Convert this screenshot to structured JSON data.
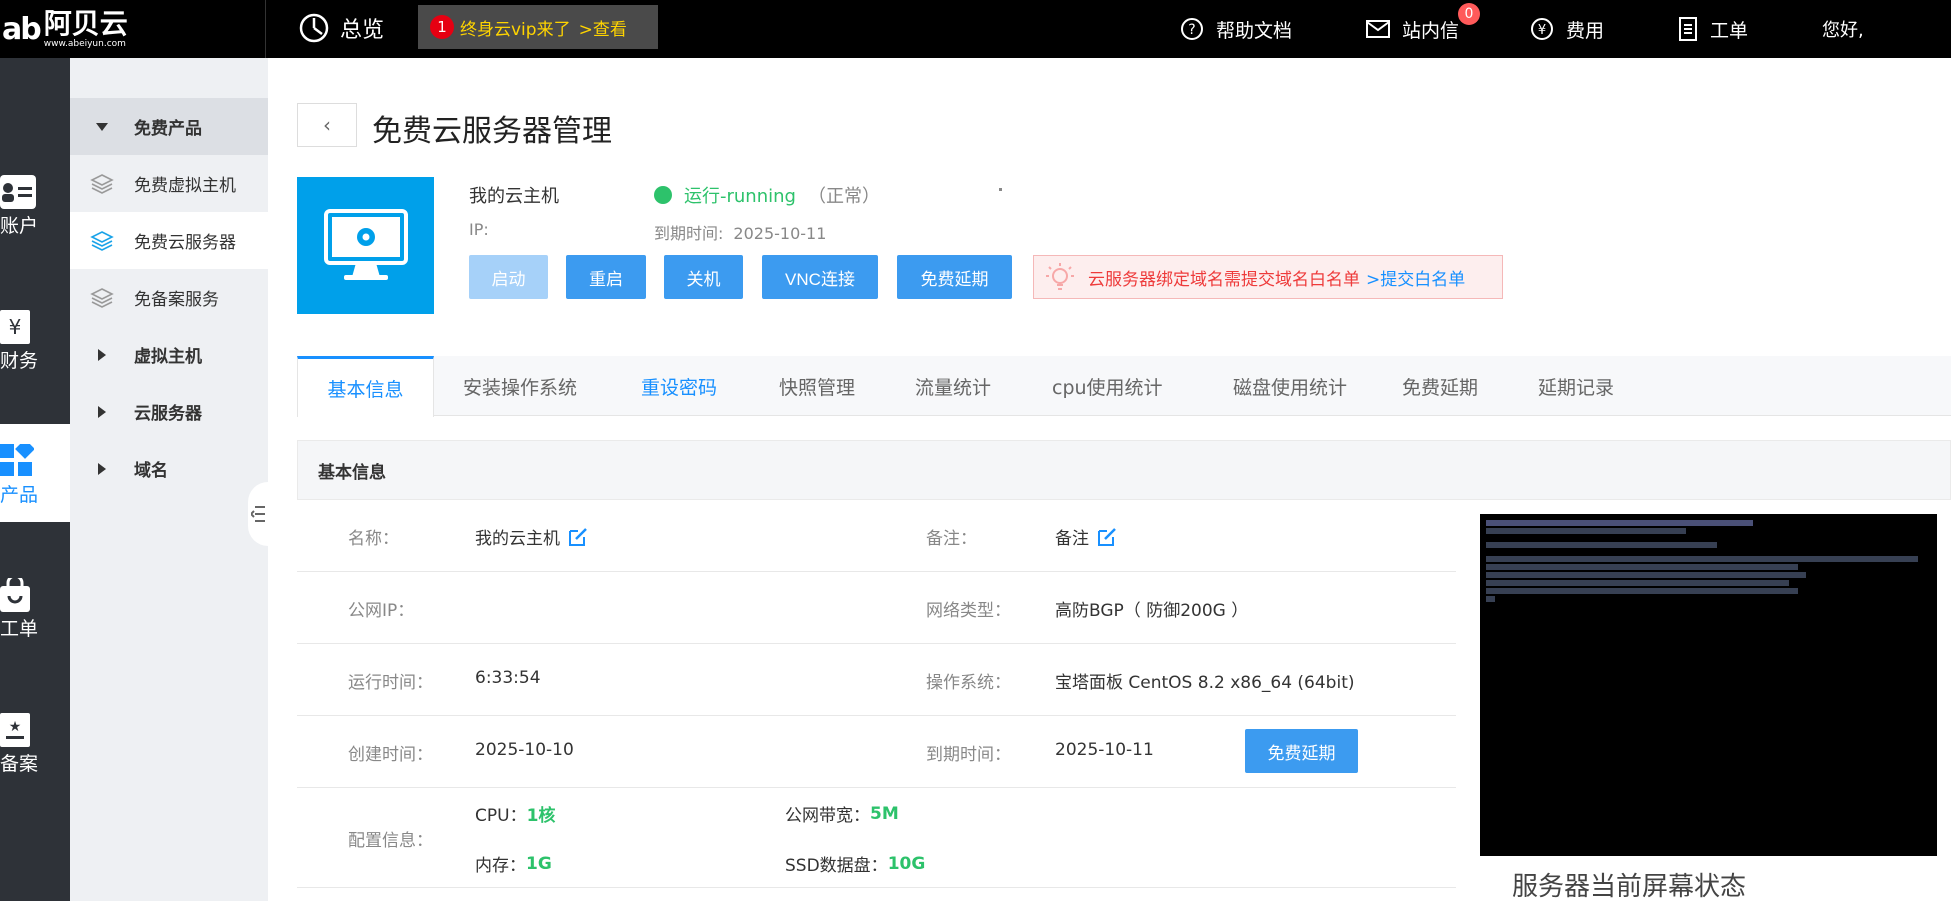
{
  "header": {
    "logo_cn": "阿贝云",
    "logo_en": "www.abeiyun.com",
    "overview": "总览",
    "promo_badge": "1",
    "promo_text": "终身云vip来了",
    "promo_link": ">查看",
    "help": "帮助文档",
    "messages": "站内信",
    "messages_count": "0",
    "fees": "费用",
    "tickets": "工单",
    "greeting": "您好,"
  },
  "rail": {
    "account": "账户",
    "finance": "财务",
    "products": "产品",
    "tickets": "工单",
    "beian": "备案"
  },
  "sidebar": {
    "free_products": "免费产品",
    "free_vhost": "免费虚拟主机",
    "free_cloud_server": "免费云服务器",
    "free_beian": "免备案服务",
    "vhost": "虚拟主机",
    "cloud_server": "云服务器",
    "domain": "域名"
  },
  "page": {
    "back": "‹",
    "title": "免费云服务器管理"
  },
  "server": {
    "name": "我的云主机",
    "status": "运行-running",
    "status_note": "（正常）",
    "ip_label": "IP:",
    "expire_label": "到期时间:",
    "expire_date": "2025-10-11"
  },
  "actions": {
    "start": "启动",
    "restart": "重启",
    "shutdown": "关机",
    "vnc": "VNC连接",
    "extend": "免费延期"
  },
  "notice": {
    "text": "云服务器绑定域名需提交域名白名单",
    "link": ">提交白名单"
  },
  "tabs": [
    "基本信息",
    "安装操作系统",
    "重设密码",
    "快照管理",
    "流量统计",
    "cpu使用统计",
    "磁盘使用统计",
    "免费延期",
    "延期记录"
  ],
  "info": {
    "head": "基本信息",
    "name_label": "名称：",
    "name_value": "我的云主机",
    "note_label": "备注：",
    "note_value": "备注",
    "ip_label": "公网IP：",
    "ip_value": "",
    "network_label": "网络类型：",
    "network_value": "高防BGP（ 防御200G ）",
    "uptime_label": "运行时间：",
    "uptime_value": "6:33:54",
    "os_label": "操作系统：",
    "os_value": "宝塔面板 CentOS 8.2 x86_64 (64bit)",
    "created_label": "创建时间：",
    "created_value": "2025-10-10",
    "expire_label": "到期时间：",
    "expire_value": "2025-10-11",
    "extend_button": "免费延期",
    "config_label": "配置信息：",
    "cpu_label": "CPU：",
    "cpu_value": "1核",
    "bandwidth_label": "公网带宽：",
    "bandwidth_value": "5M",
    "mem_label": "内存：",
    "mem_value": "1G",
    "disk_label": "SSD数据盘：",
    "disk_value": "10G"
  },
  "screen_caption": "服务器当前屏幕状态",
  "colors": {
    "primary": "#3c9bf0",
    "link": "#1890ff",
    "success": "#2dc26b",
    "danger": "#ee3b3b",
    "topbar": "#000000",
    "rail": "#2e3238"
  }
}
